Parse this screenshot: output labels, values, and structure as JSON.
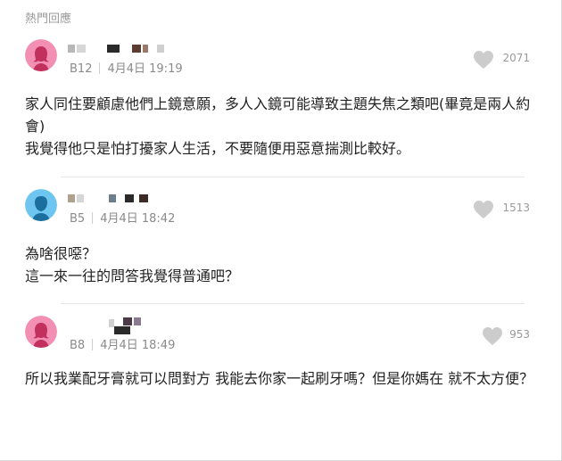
{
  "section_title": "熱門回應",
  "replies": [
    {
      "avatar": "female-avatar-icon",
      "avatar_color": "#f28fb3",
      "floor": "B12",
      "time": "4月4日 19:19",
      "likes": "2071",
      "content": [
        "家人同住要顧慮他們上鏡意願，多人入鏡可能導致主題失焦之類吧(畢竟是兩人約會)",
        "我覺得他只是怕打擾家人生活，不要隨便用惡意揣測比較好。"
      ]
    },
    {
      "avatar": "male-avatar-icon",
      "avatar_color": "#6ec6f0",
      "floor": "B5",
      "time": "4月4日 18:42",
      "likes": "1513",
      "content": [
        "為啥很噁？",
        "這一來一往的問答我覺得普通吧？"
      ]
    },
    {
      "avatar": "female-avatar-icon",
      "avatar_color": "#f28fb3",
      "floor": "B8",
      "time": "4月4日 18:49",
      "likes": "953",
      "content": [
        "所以我業配牙膏就可以問對方 我能去你家一起刷牙嗎？但是你媽在 就不太方便？"
      ]
    }
  ],
  "colors": {
    "heart": "#cccccc",
    "meta_text": "#8a8a8a",
    "divider": "#e6e6e6"
  }
}
